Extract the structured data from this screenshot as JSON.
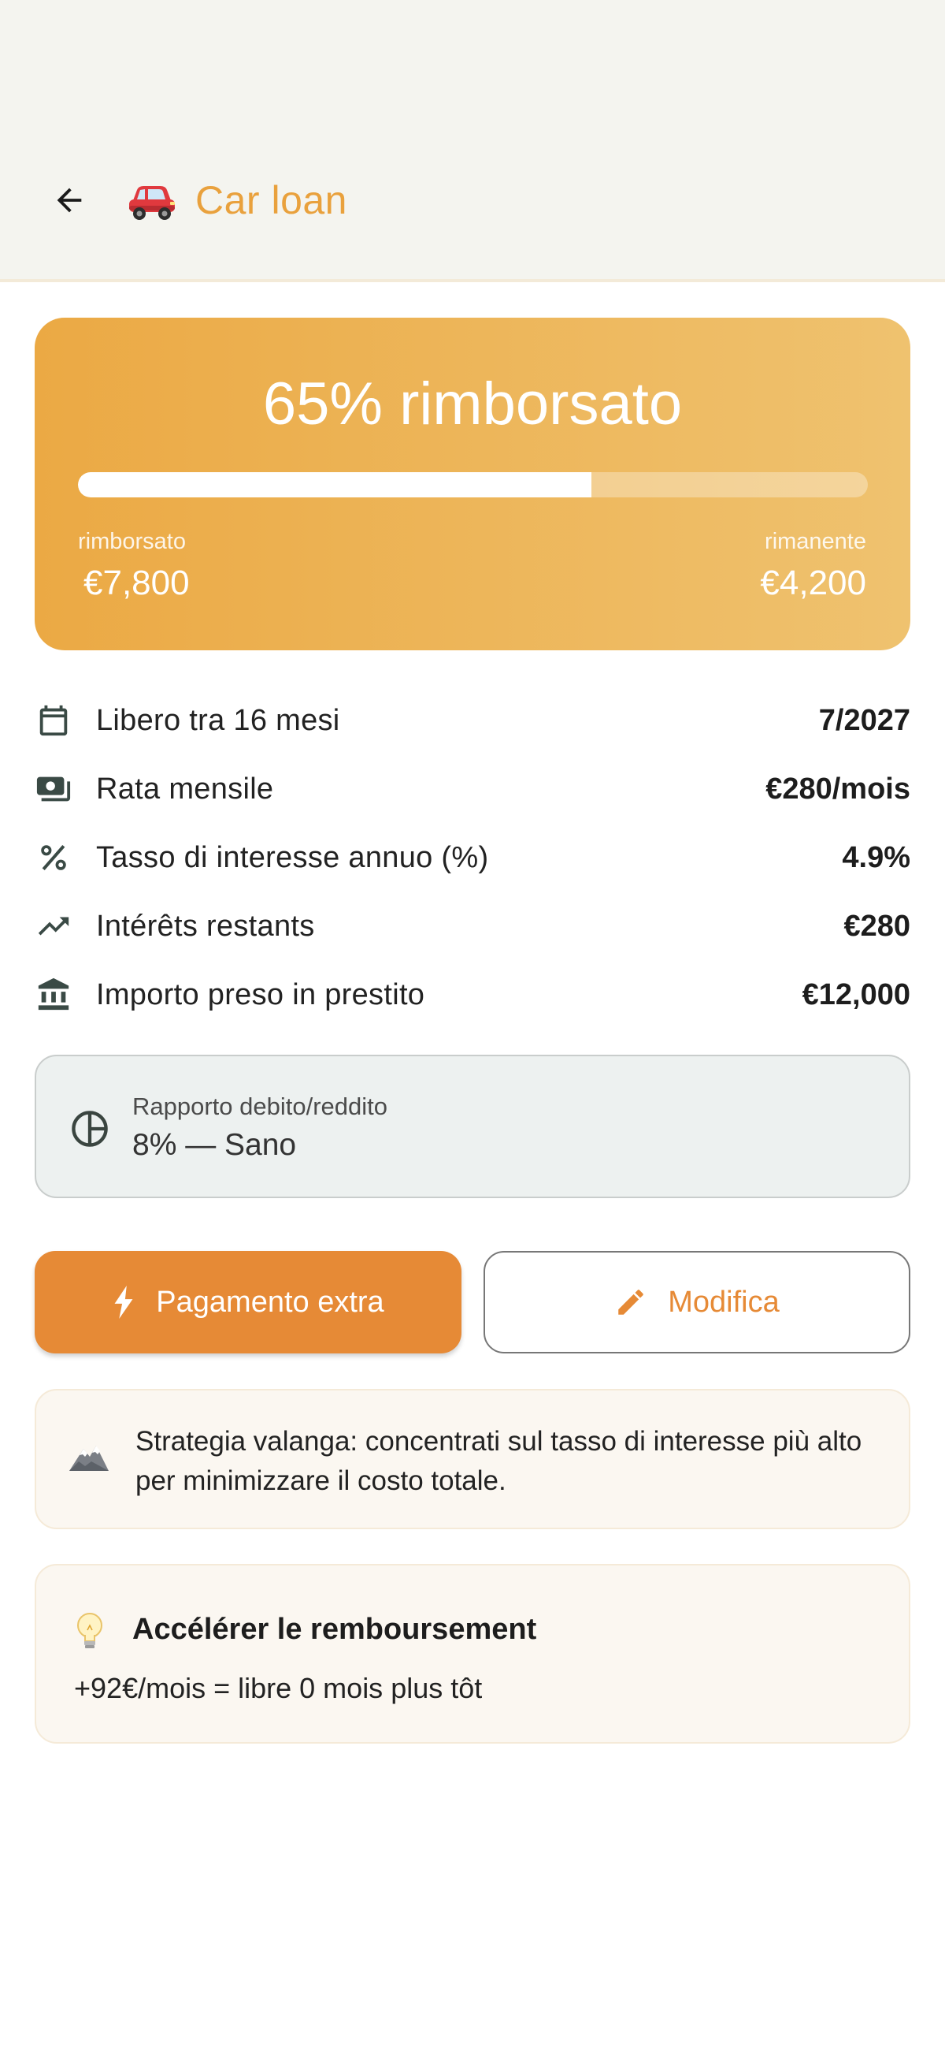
{
  "header": {
    "title": "Car loan",
    "back_icon": "arrow-left-icon",
    "emoji": "red-car-emoji"
  },
  "hero": {
    "headline": "65% rimborsato",
    "progress_fraction": 0.65,
    "paid_label": "rimborsato",
    "paid_value": "€7,800",
    "remaining_label": "rimanente",
    "remaining_value": "€4,200",
    "colors": {
      "gradient_start": "#eba944",
      "gradient_end": "#efc26f"
    }
  },
  "details": [
    {
      "icon": "calendar-icon",
      "label": "Libero tra 16 mesi",
      "value": "7/2027"
    },
    {
      "icon": "payments-icon",
      "label": "Rata mensile",
      "value": "€280/mois"
    },
    {
      "icon": "percent-icon",
      "label": "Tasso di interesse annuo (%)",
      "value": "4.9%"
    },
    {
      "icon": "trending-up-icon",
      "label": "Intérêts restants",
      "value": "€280"
    },
    {
      "icon": "bank-icon",
      "label": "Importo preso in prestito",
      "value": "€12,000"
    }
  ],
  "ratio": {
    "icon": "pie-chart-icon",
    "label": "Rapporto debito/reddito",
    "value": "8% — Sano"
  },
  "actions": {
    "extra_payment_label": "Pagamento extra",
    "extra_payment_icon": "bolt-icon",
    "edit_label": "Modifica",
    "edit_icon": "pencil-icon",
    "accent_color": "#e68a36"
  },
  "strategy": {
    "icon": "mountain-icon",
    "text": "Strategia valanga: concentrati sul tasso di interesse più alto per minimizzare il costo totale."
  },
  "accelerate": {
    "icon": "lightbulb-icon",
    "title": "Accélérer le remboursement",
    "body": "+92€/mois = libre 0 mois plus tôt"
  }
}
